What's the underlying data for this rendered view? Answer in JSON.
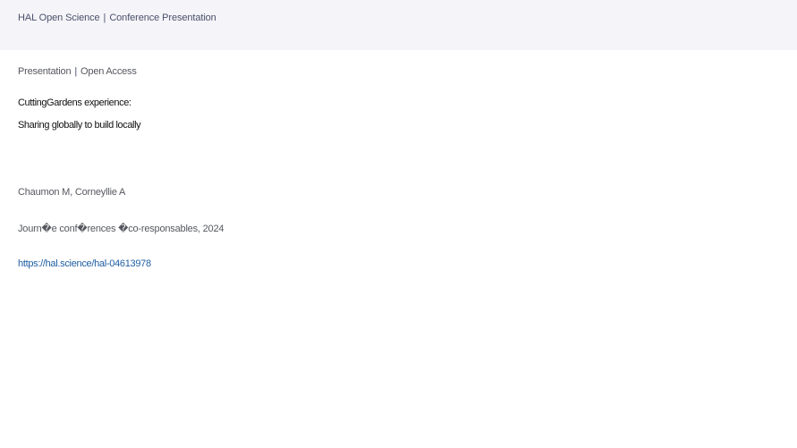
{
  "header": {
    "site_name": "HAL Open Science",
    "separator": "|",
    "doc_kind": "Conference Presentation"
  },
  "record": {
    "type": "Presentation",
    "separator": "|",
    "access": "Open Access",
    "title_line1": "CuttingGardens experience:",
    "title_line2": "Sharing globally to build locally",
    "authors": "Chaumon M, Corneyllie A",
    "venue": "Journ�e conf�rences �co-responsables, 2024",
    "url": "https://hal.science/hal-04613978"
  }
}
